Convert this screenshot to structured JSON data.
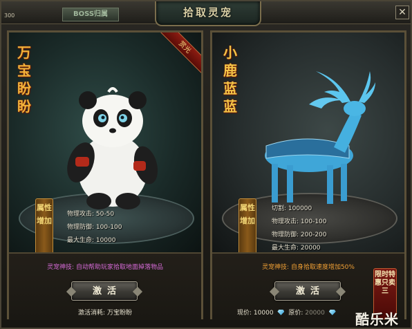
{
  "window": {
    "title": "拾取灵宠",
    "boss_tag": "BOSS归属",
    "corner_number": "300",
    "close_label": "✕"
  },
  "pets": [
    {
      "name": "万宝盼盼",
      "ribbon": "赏光",
      "attr_tag": "属性增加",
      "stats": [
        "物理攻击: 50-50",
        "物理防御: 100-100",
        "最大生命: 10000"
      ],
      "skill_label": "灵宠神技:",
      "skill_desc": "自动帮助玩家拾取地面掉落物品",
      "button": "激活",
      "cost_label": "激活消耗:",
      "cost_item": "万宝盼盼"
    },
    {
      "name": "小鹿蓝蓝",
      "attr_tag": "属性增加",
      "stats": [
        "切割: 100000",
        "物理攻击: 100-100",
        "物理防御: 200-200",
        "最大生命: 20000"
      ],
      "skill_label": "灵宠神技:",
      "skill_desc": "自身拾取速度增加50%",
      "button": "激活",
      "price_label": "现价:",
      "price_value": "10000",
      "orig_label": "原价:",
      "orig_value": "20000",
      "limited_badge": "限时特惠只卖三"
    }
  ],
  "watermark": "酷乐米",
  "colors": {
    "pet_name": "#f1b23a",
    "skill_purple": "#d56ad6",
    "skill_orange": "#f1a035",
    "panda_scene": "#2f4b47",
    "deer_body": "#3fa6d8"
  }
}
